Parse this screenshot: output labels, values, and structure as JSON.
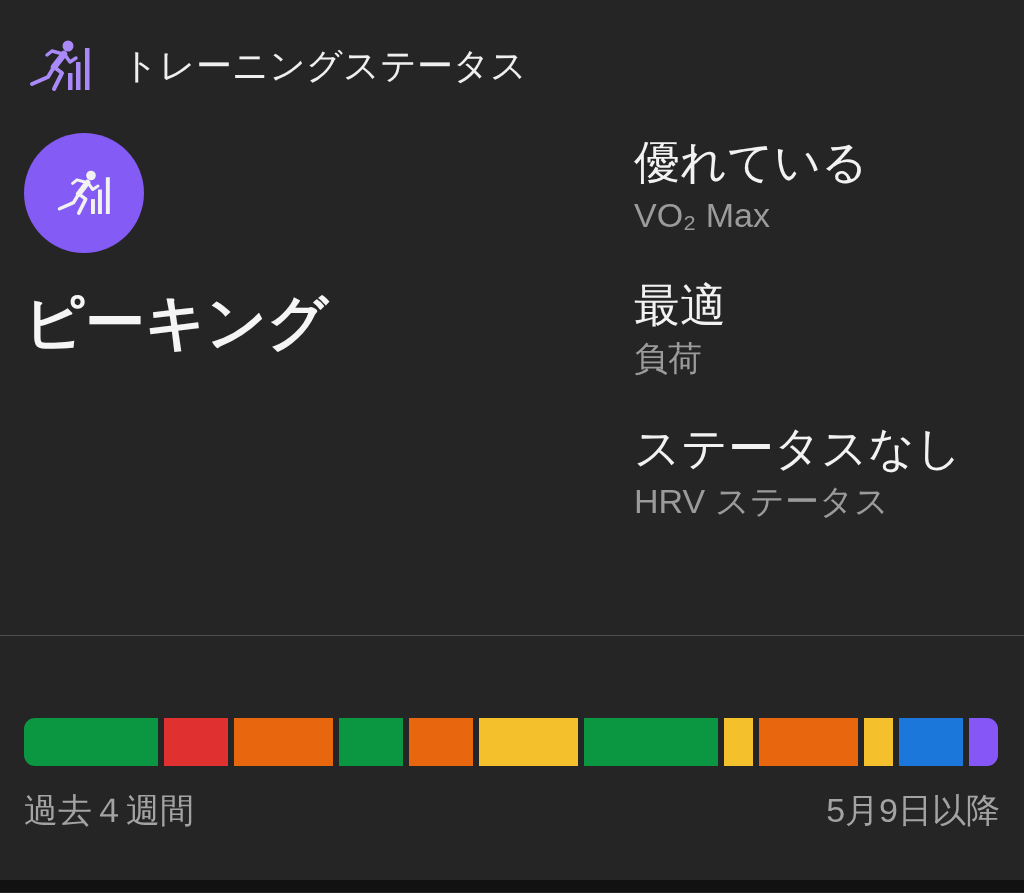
{
  "header": {
    "title": "トレーニングステータス"
  },
  "status": {
    "label": "ピーキング"
  },
  "metrics": [
    {
      "value": "優れている",
      "label": "VO₂ Max"
    },
    {
      "value": "最適",
      "label": "負荷"
    },
    {
      "value": "ステータスなし",
      "label": "HRV ステータス"
    }
  ],
  "history": {
    "days": [
      {
        "color": "#0b9641"
      },
      {
        "color": "#0b9641"
      },
      {
        "color": "#0b9641"
      },
      {
        "color": "#0b9641"
      },
      {
        "color": "#e0302f"
      },
      {
        "color": "#e0302f"
      },
      {
        "color": "#e8670e"
      },
      {
        "color": "#e8670e"
      },
      {
        "color": "#e8670e"
      },
      {
        "color": "#0b9641"
      },
      {
        "color": "#0b9641"
      },
      {
        "color": "#e8670e"
      },
      {
        "color": "#e8670e"
      },
      {
        "color": "#f4c02b"
      },
      {
        "color": "#f4c02b"
      },
      {
        "color": "#f4c02b"
      },
      {
        "color": "#0b9641"
      },
      {
        "color": "#0b9641"
      },
      {
        "color": "#0b9641"
      },
      {
        "color": "#0b9641"
      },
      {
        "color": "#f4c02b"
      },
      {
        "color": "#e8670e"
      },
      {
        "color": "#e8670e"
      },
      {
        "color": "#e8670e"
      },
      {
        "color": "#f4c02b"
      },
      {
        "color": "#1b77d9"
      },
      {
        "color": "#1b77d9"
      },
      {
        "color": "#8657f6"
      }
    ],
    "start_label": "過去４週間",
    "end_label": "5月9日以降"
  }
}
